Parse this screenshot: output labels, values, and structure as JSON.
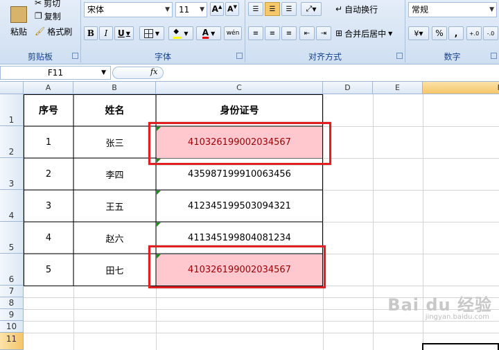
{
  "clipboard": {
    "paste": "粘贴",
    "cut": "剪切",
    "copy": "复制",
    "format_painter": "格式刷",
    "group_label": "剪贴板"
  },
  "font": {
    "name": "宋体",
    "size": "11",
    "bold": "B",
    "italic": "I",
    "underline": "U",
    "font_color_glyph": "A",
    "phonetic": "wén",
    "group_label": "字体"
  },
  "alignment": {
    "wrap_text": "自动换行",
    "merge_center": "合并后居中",
    "group_label": "对齐方式"
  },
  "number": {
    "format": "常规",
    "percent": "%",
    "comma": ",",
    "increase_decimal": ".0→.00",
    "decrease_decimal": ".00→.0",
    "group_label": "数字"
  },
  "formula_bar": {
    "name_box": "F11",
    "fx": "fx",
    "content": ""
  },
  "columns": [
    "A",
    "B",
    "C",
    "D",
    "E",
    "F"
  ],
  "rows": [
    "1",
    "2",
    "3",
    "4",
    "5",
    "6",
    "7",
    "8",
    "9",
    "10",
    "11"
  ],
  "table": {
    "headers": [
      "序号",
      "姓名",
      "身份证号"
    ],
    "records": [
      {
        "no": "1",
        "name": "张三",
        "id": "410326199002034567",
        "duplicate": true
      },
      {
        "no": "2",
        "name": "李四",
        "id": "435987199910063456",
        "duplicate": false
      },
      {
        "no": "3",
        "name": "王五",
        "id": "412345199503094321",
        "duplicate": false
      },
      {
        "no": "4",
        "name": "赵六",
        "id": "411345199804081234",
        "duplicate": false
      },
      {
        "no": "5",
        "name": "田七",
        "id": "410326199002034567",
        "duplicate": true
      }
    ]
  },
  "colors": {
    "highlight_fill": "#ffc7ce",
    "highlight_text": "#9c0006",
    "annotation": "#e02020",
    "selected_col": "#f9d57a"
  },
  "watermark": {
    "brand": "Bai du 经验",
    "url": "jingyan.baidu.com"
  }
}
